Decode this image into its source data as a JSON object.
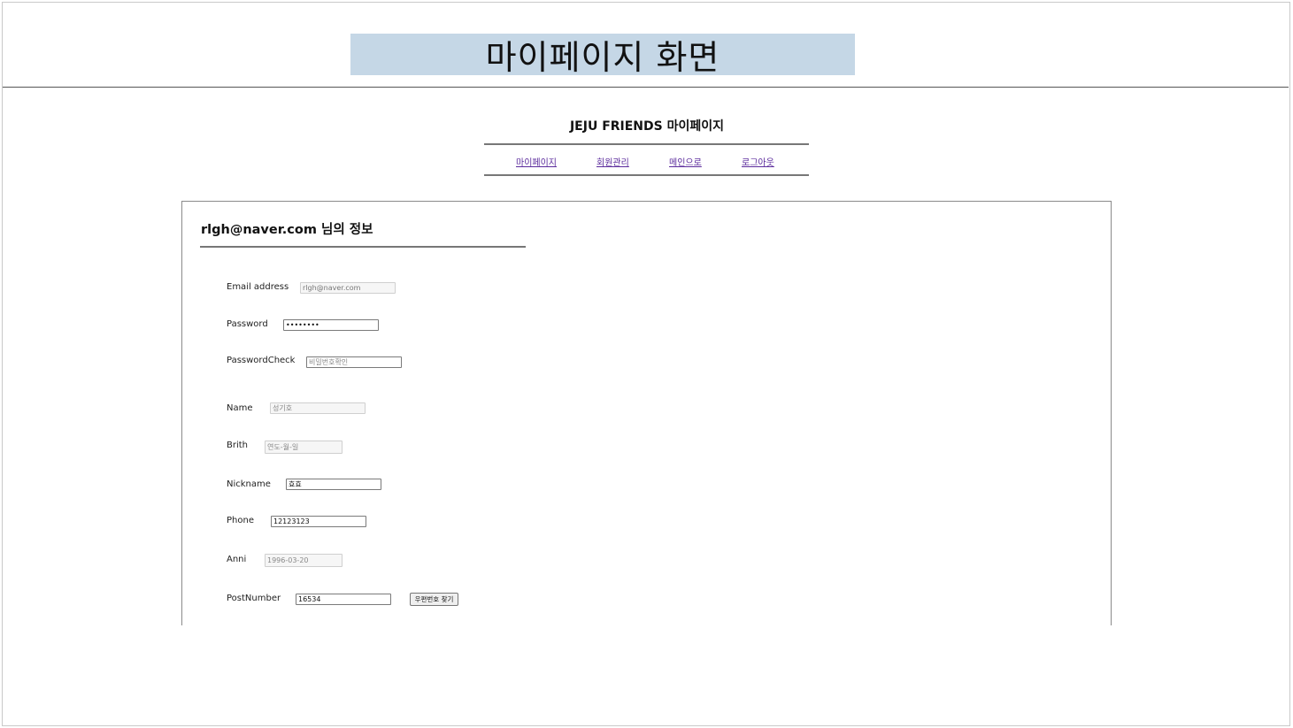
{
  "slide": {
    "title": "마이페이지 화면"
  },
  "header": {
    "site_title": "JEJU FRIENDS 마이페이지",
    "nav": [
      {
        "label": "마이페이지"
      },
      {
        "label": "회원관리"
      },
      {
        "label": "메인으로"
      },
      {
        "label": "로그아웃"
      }
    ]
  },
  "profile": {
    "heading": "rlgh@naver.com 님의 정보",
    "fields": {
      "email": {
        "label": "Email address",
        "value": "rlgh@naver.com"
      },
      "password": {
        "label": "Password",
        "value": "••••••••"
      },
      "password_check": {
        "label": "PasswordCheck",
        "placeholder": "비밀번호확인"
      },
      "name": {
        "label": "Name",
        "placeholder": "성기호"
      },
      "birth": {
        "label": "Brith",
        "placeholder": "연도-월-일"
      },
      "nickname": {
        "label": "Nickname",
        "value": "효효"
      },
      "phone": {
        "label": "Phone",
        "value": "12123123"
      },
      "anni": {
        "label": "Anni",
        "placeholder": "1996-03-20"
      },
      "post_number": {
        "label": "PostNumber",
        "value": "16534"
      }
    },
    "post_search_button": "우편번호 찾기"
  }
}
